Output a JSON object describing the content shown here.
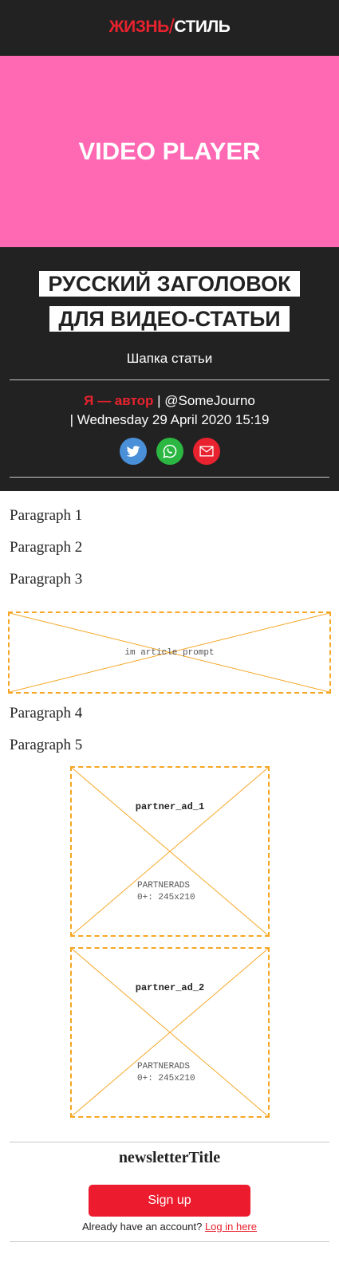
{
  "header": {
    "logo_part1": "ЖИЗНЬ",
    "logo_slash": "/",
    "logo_part2": "СТИЛЬ",
    "brand_color": "#e8222e"
  },
  "video": {
    "label": "VIDEO PLAYER",
    "background": "#ff69b4"
  },
  "article": {
    "headline_line1": "РУССКИЙ ЗАГОЛОВОК",
    "headline_line2": "ДЛЯ ВИДЕО-СТАТЬИ",
    "standfirst": "Шапка статьи",
    "author": "Я — автор",
    "separator1": " | ",
    "handle": "@SomeJourno",
    "date_line": "| Wednesday 29 April 2020 15:19",
    "share": [
      {
        "name": "twitter-icon",
        "color": "#4a90d9"
      },
      {
        "name": "whatsapp-icon",
        "color": "#2cb742"
      },
      {
        "name": "email-icon",
        "color": "#e8222e"
      }
    ]
  },
  "body": {
    "paragraphs": [
      "Paragraph 1",
      "Paragraph 2",
      "Paragraph 3",
      "Paragraph 4",
      "Paragraph 5"
    ],
    "prompt_placeholder": "im article prompt",
    "ads": [
      {
        "title": "partner_ad_1",
        "tag_line1": "PARTNERADS",
        "tag_line2": "0+: 245x210"
      },
      {
        "title": "partner_ad_2",
        "tag_line1": "PARTNERADS",
        "tag_line2": "0+: 245x210"
      }
    ],
    "placeholder_color": "#f5a623"
  },
  "newsletter": {
    "title": "newsletterTitle",
    "signup_label": "Sign up",
    "already_text": "Already have an account?",
    "login_label": "Log in here"
  }
}
